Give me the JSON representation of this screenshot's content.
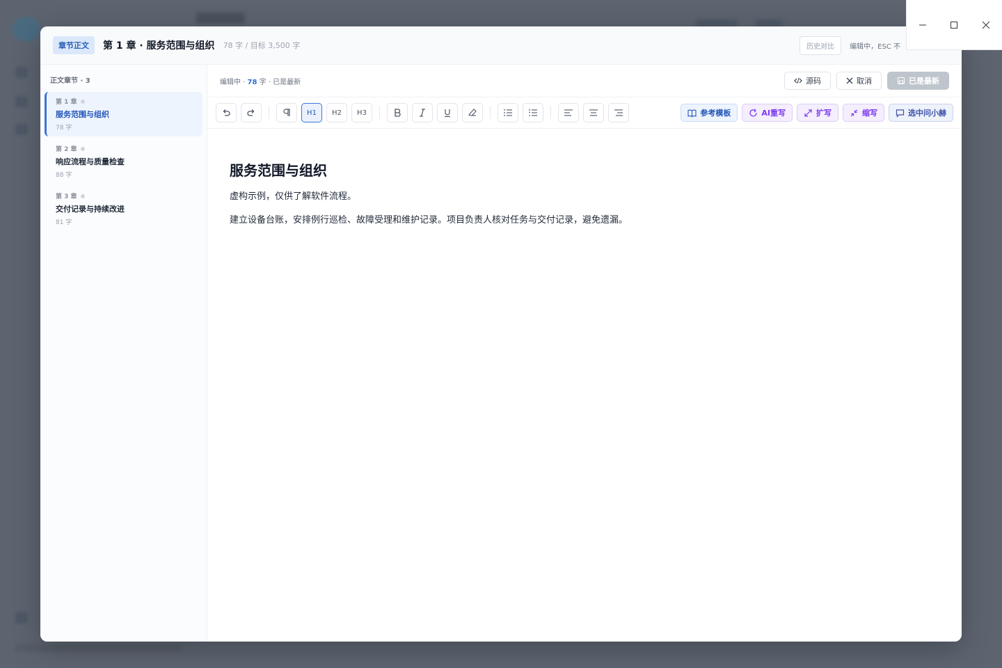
{
  "window_controls": {
    "minimize_icon": "minimize-icon",
    "maximize_icon": "maximize-icon",
    "close_icon": "close-icon"
  },
  "header": {
    "badge": "章节正文",
    "title": "第 1 章 · 服务范围与组织",
    "word_count": "78 字 / 目标 3,500 字",
    "history_button": "历史对比",
    "hint": "编辑中，ESC 不"
  },
  "sidebar": {
    "heading": "正文章节 · 3",
    "chapters": [
      {
        "num": "第 1 章",
        "name": "服务范围与组织",
        "words": "78 字",
        "active": true
      },
      {
        "num": "第 2 章",
        "name": "响应流程与质量检查",
        "words": "88 字",
        "active": false
      },
      {
        "num": "第 3 章",
        "name": "交付记录与持续改进",
        "words": "81 字",
        "active": false
      }
    ]
  },
  "status": {
    "prefix": "编辑中 · ",
    "count": "78",
    "suffix": " 字 · 已是最新",
    "source_button": "源码",
    "cancel_button": "取消",
    "save_button": "已是最新"
  },
  "toolbar": {
    "h1": "H1",
    "h2": "H2",
    "h3": "H3",
    "template_button": "参考模板",
    "ai_rewrite_button": "AI重写",
    "expand_button": "扩写",
    "shrink_button": "缩写",
    "ask_button": "选中问小赫"
  },
  "editor": {
    "heading": "服务范围与组织",
    "paragraphs": [
      "虚构示例，仅供了解软件流程。",
      "建立设备台账，安排例行巡检、故障受理和维护记录。项目负责人核对任务与交付记录，避免遗漏。"
    ]
  }
}
